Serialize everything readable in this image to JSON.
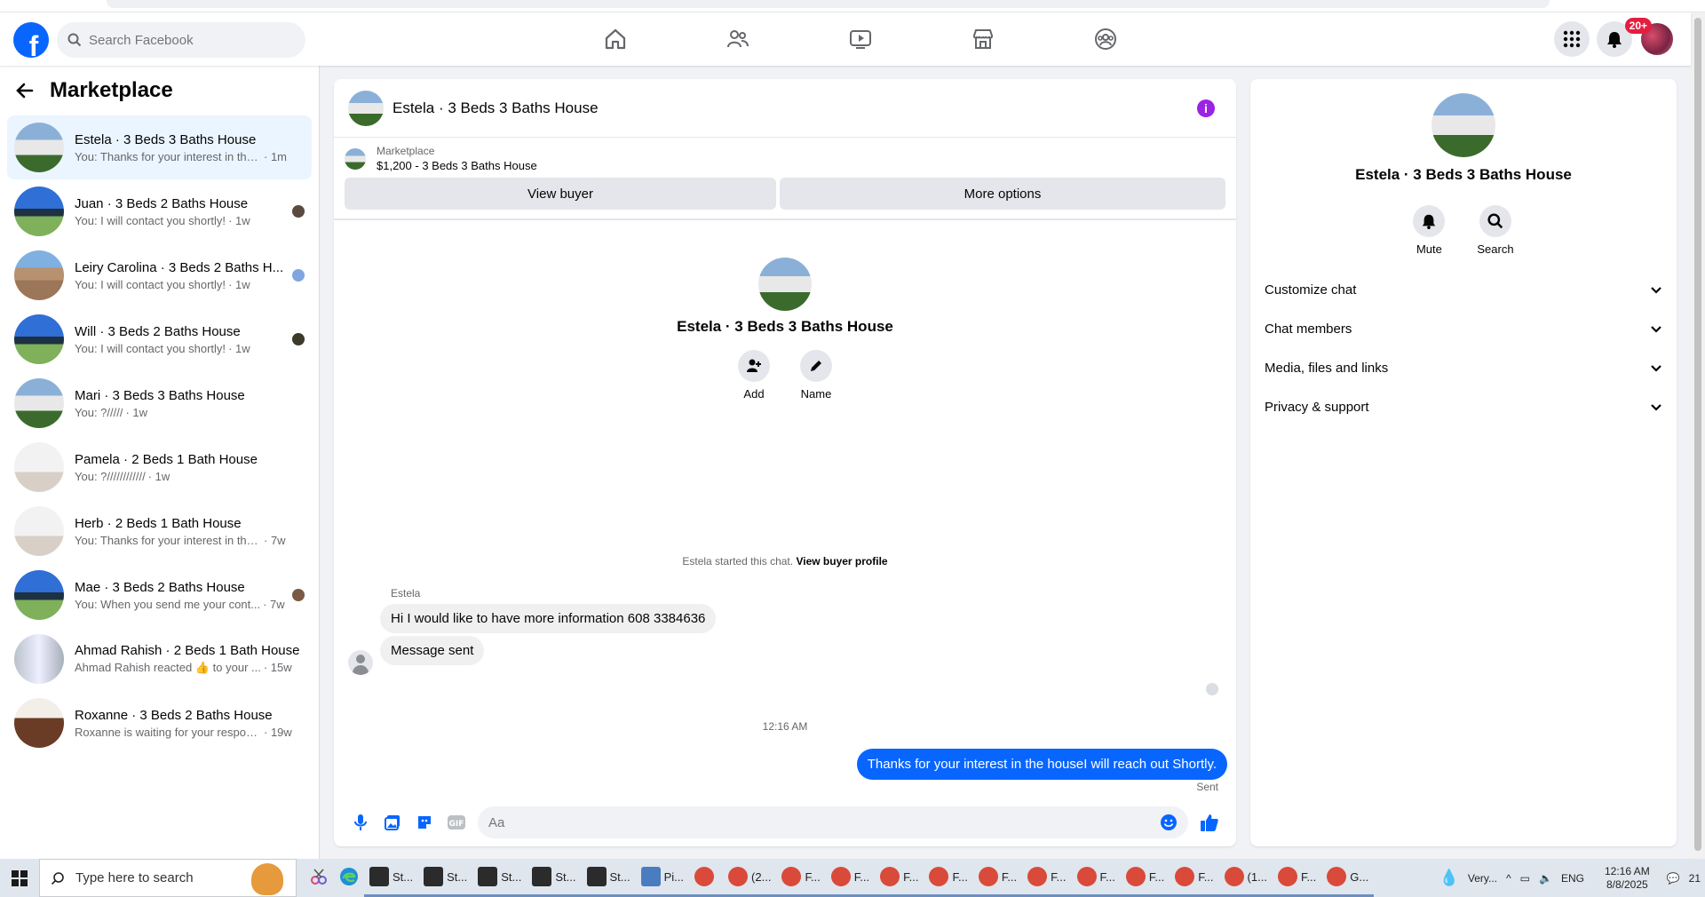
{
  "header": {
    "search_placeholder": "Search Facebook",
    "notifications_badge": "20+"
  },
  "left": {
    "title": "Marketplace",
    "conversations": [
      {
        "name": "Estela · 3 Beds 3 Baths House",
        "preview": "You: Thanks for your interest in the h...",
        "time": "· 1m",
        "active": true
      },
      {
        "name": "Juan · 3 Beds 2 Baths House",
        "preview": "You: I will contact you shortly!",
        "time": "· 1w"
      },
      {
        "name": "Leiry Carolina · 3 Beds 2 Baths H...",
        "preview": "You: I will contact you shortly!",
        "time": "· 1w"
      },
      {
        "name": "Will · 3 Beds 2 Baths House",
        "preview": "You: I will contact you shortly!",
        "time": "· 1w"
      },
      {
        "name": "Mari · 3 Beds 3 Baths House",
        "preview": "You: ?/////",
        "time": "· 1w"
      },
      {
        "name": "Pamela · 2 Beds 1 Bath House",
        "preview": "You: ?////////////",
        "time": "· 1w"
      },
      {
        "name": "Herb · 2 Beds 1 Bath House",
        "preview": "You: Thanks for your interest in the h...",
        "time": "· 7w"
      },
      {
        "name": "Mae · 3 Beds 2 Baths House",
        "preview": "You: When you send me your cont...",
        "time": "· 7w"
      },
      {
        "name": "Ahmad Rahish · 2 Beds 1 Bath House",
        "preview": "Ahmad Rahish reacted 👍 to your ...",
        "time": "· 15w"
      },
      {
        "name": "Roxanne · 3 Beds 2 Baths House",
        "preview": "Roxanne is waiting for your response.",
        "time": "· 19w"
      }
    ]
  },
  "chat": {
    "title": "Estela · 3 Beds 3 Baths House",
    "marketplace_label": "Marketplace",
    "listing": "$1,200 - 3 Beds 3 Baths House",
    "view_buyer": "View buyer",
    "more_options": "More options",
    "profile_name": "Estela · 3 Beds 3 Baths House",
    "add_label": "Add",
    "name_label": "Name",
    "started_text": "Estela started this chat.",
    "view_buyer_profile": "View buyer profile",
    "sender": "Estela",
    "msg1": "Hi I would like to have more information 608 3384636",
    "msg2": "Message sent",
    "timestamp": "12:16 AM",
    "msg_out": "Thanks for your interest in the houseI will reach out Shortly.",
    "sent_label": "Sent",
    "composer_placeholder": "Aa"
  },
  "right": {
    "name": "Estela · 3 Beds 3 Baths House",
    "mute": "Mute",
    "search": "Search",
    "sections": [
      "Customize chat",
      "Chat members",
      "Media, files and links",
      "Privacy & support"
    ]
  },
  "taskbar": {
    "search_placeholder": "Type here to search",
    "apps": [
      {
        "label": "St...",
        "color": "#2b2b2b"
      },
      {
        "label": "St...",
        "color": "#2b2b2b"
      },
      {
        "label": "St...",
        "color": "#2b2b2b"
      },
      {
        "label": "St...",
        "color": "#2b2b2b"
      },
      {
        "label": "St...",
        "color": "#2b2b2b"
      },
      {
        "label": "Pi...",
        "color": "#4a7cc0"
      },
      {
        "label": "",
        "color": "#d94a3a"
      },
      {
        "label": "(2...",
        "color": "#d94a3a"
      },
      {
        "label": "F...",
        "color": "#d94a3a"
      },
      {
        "label": "F...",
        "color": "#d94a3a"
      },
      {
        "label": "F...",
        "color": "#d94a3a"
      },
      {
        "label": "F...",
        "color": "#d94a3a"
      },
      {
        "label": "F...",
        "color": "#d94a3a"
      },
      {
        "label": "F...",
        "color": "#d94a3a"
      },
      {
        "label": "F...",
        "color": "#d94a3a"
      },
      {
        "label": "F...",
        "color": "#d94a3a"
      },
      {
        "label": "F...",
        "color": "#d94a3a"
      },
      {
        "label": "(1...",
        "color": "#d94a3a"
      },
      {
        "label": "F...",
        "color": "#d94a3a"
      },
      {
        "label": "G...",
        "color": "#d94a3a"
      }
    ],
    "weather": "Very...",
    "lang": "ENG",
    "time": "12:16 AM",
    "date": "8/8/2025",
    "notif_count": "21"
  },
  "colors": {
    "accent": "#0866ff",
    "info": "#9a23e6"
  }
}
